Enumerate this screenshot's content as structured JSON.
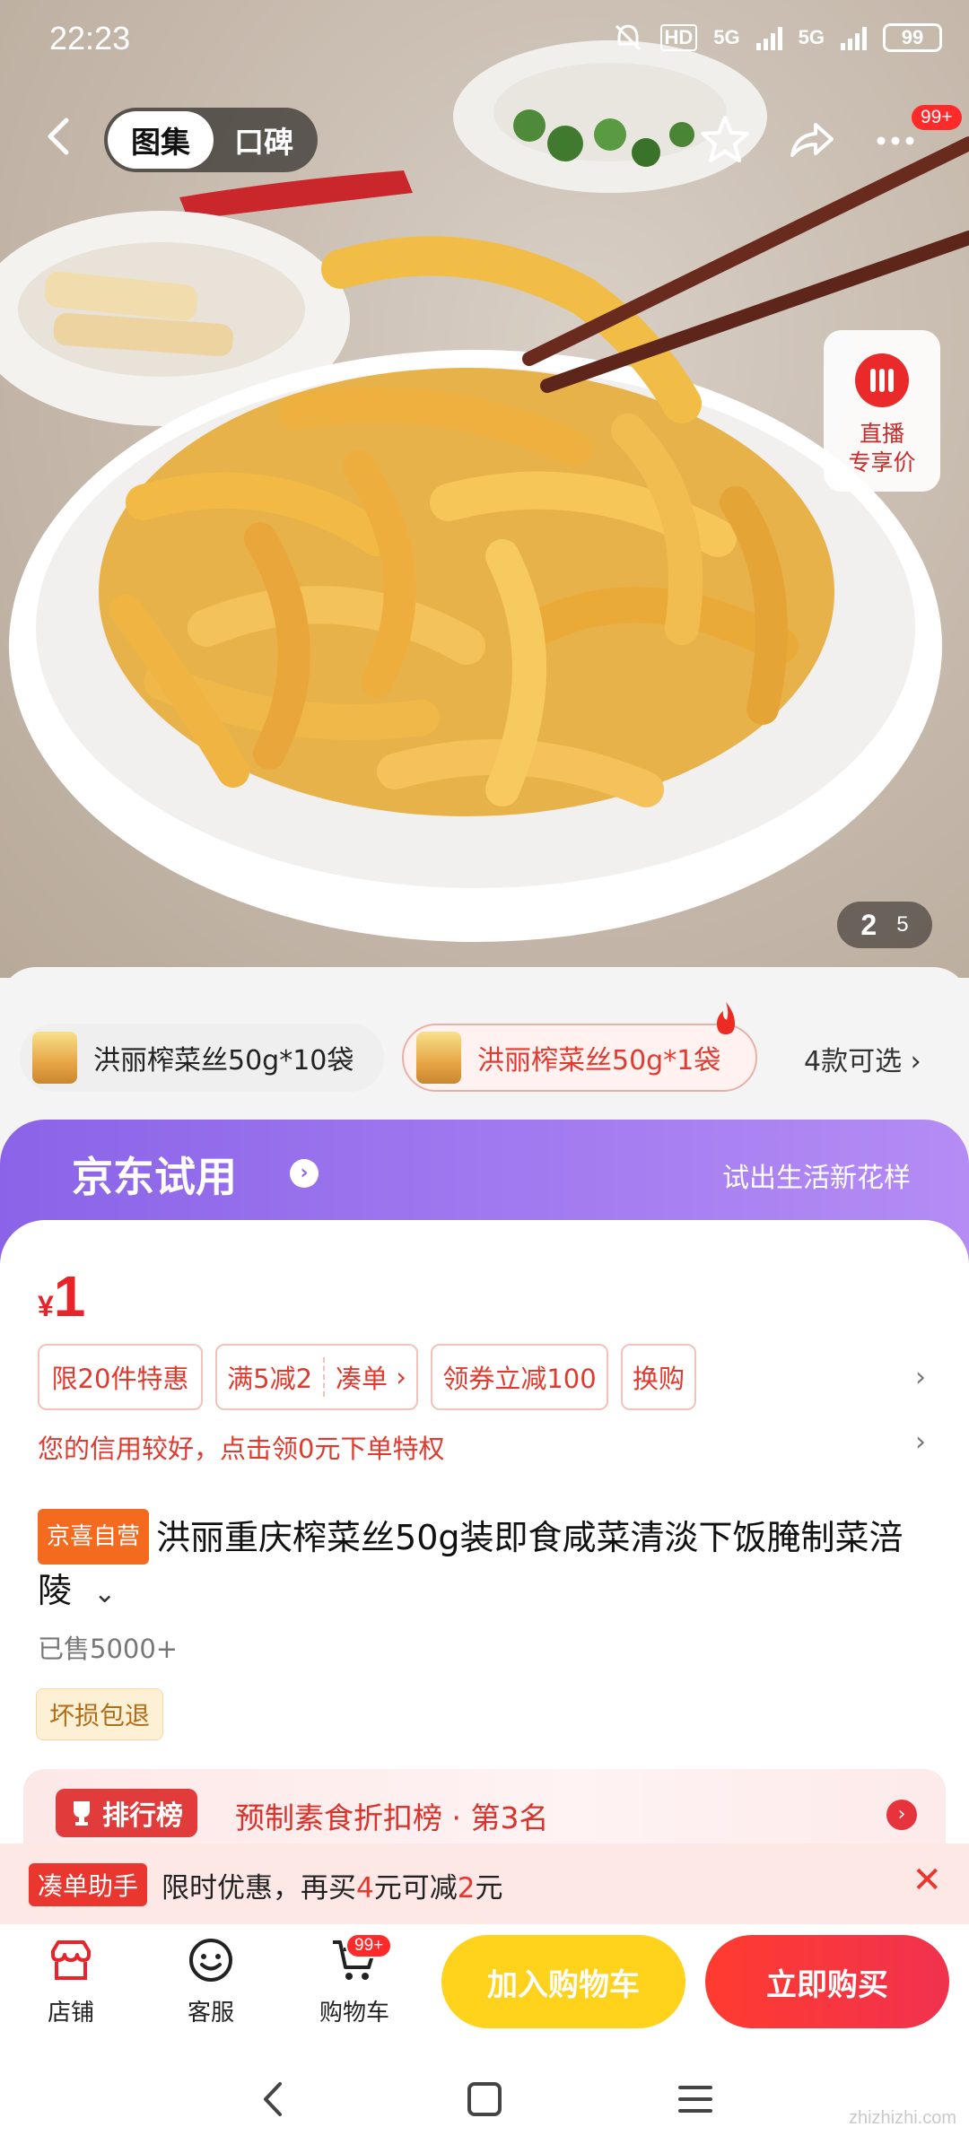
{
  "status_bar": {
    "time": "22:23",
    "hd_label": "HD",
    "net1": "5G",
    "net2": "5G",
    "battery": "99"
  },
  "top_nav": {
    "tab_gallery": "图集",
    "tab_reviews": "口碑",
    "menu_badge": "99+"
  },
  "live": {
    "line1": "直播",
    "line2": "专享价"
  },
  "pager": {
    "current": "2",
    "total": "5"
  },
  "variants": {
    "items": [
      "洪丽榨菜丝50g*10袋",
      "洪丽榨菜丝50g*1袋"
    ],
    "more": "4款可选"
  },
  "trial_banner": {
    "title": "京东试用",
    "subtitle": "试出生活新花样"
  },
  "price": {
    "symbol": "¥",
    "value": "1"
  },
  "promos": [
    "限20件特惠",
    "满5减2",
    "凑单",
    "领券立减100",
    "换购"
  ],
  "credit_notice": "您的信用较好，点击领0元下单特权",
  "product": {
    "store_tag": "京喜自营",
    "title": "洪丽重庆榨菜丝50g装即食咸菜清淡下饭腌制菜涪陵",
    "sold": "已售5000+",
    "service_tag": "坏损包退"
  },
  "ranking": {
    "tag": "排行榜",
    "text": "预制素食折扣榜 · 第3名"
  },
  "helper": {
    "tag": "凑单助手",
    "msg_a": "限时优惠，再买",
    "amount1": "4",
    "msg_b": "元可减",
    "amount2": "2",
    "msg_c": "元"
  },
  "bottom_bar": {
    "store": "店铺",
    "service": "客服",
    "cart": "购物车",
    "cart_badge": "99+",
    "add_to_cart": "加入购物车",
    "buy_now": "立即购买"
  },
  "watermark": "zhizhizhi.com",
  "colors": {
    "accent_red": "#e6242a",
    "trial_purple": "#8a63e8",
    "cart_yellow": "#ffd21c"
  }
}
